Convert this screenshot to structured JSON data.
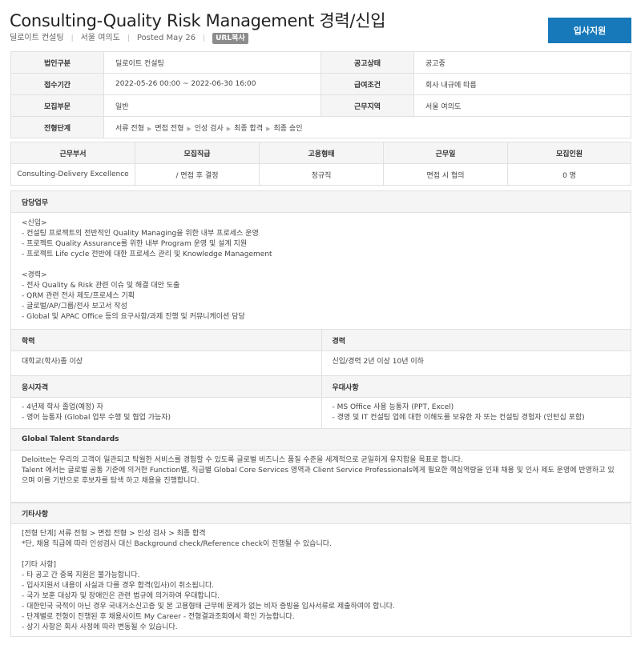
{
  "header": {
    "title": "Consulting-Quality Risk Management 경력/신입",
    "company": "딜로이트 컨설팅",
    "location": "서울 여의도",
    "posted": "Posted May 26",
    "url_copy": "URL복사",
    "apply_label": "입사지원"
  },
  "info": {
    "corp_label": "법인구분",
    "corp_value": "딜로이트 컨설팅",
    "status_label": "공고상태",
    "status_value": "공고중",
    "period_label": "접수기간",
    "period_value": "2022-05-26 00:00 ~ 2022-06-30 16:00",
    "salary_label": "급여조건",
    "salary_value": "회사 내규에 따름",
    "dept_label": "모집부문",
    "dept_value": "일반",
    "workplace_label": "근무지역",
    "workplace_value": "서울 여의도",
    "process_label": "전형단계",
    "process_steps": [
      "서류 전형",
      "면접 전형",
      "인성 검사",
      "최종 합격",
      "최종 승인"
    ]
  },
  "positions": {
    "headers": [
      "근무부서",
      "모집직급",
      "고용형태",
      "근무일",
      "모집인원"
    ],
    "row": [
      "Consulting-Delivery Excellence",
      "/ 면접 후 결정",
      "정규직",
      "면접 시 협의",
      "0 명"
    ]
  },
  "duties": {
    "title": "담당업무",
    "body": "<신입>\n- 컨설팅 프로젝트의 전반적인 Quality Managing을 위한 내부 프로세스 운영\n- 프로젝트 Quality Assurance를 위한 내부 Program 운영 및 설계 지원\n- 프로젝트 Life cycle 전반에 대한 프로세스 관리 및 Knowledge Management\n\n<경력>\n- 전사 Quality & Risk 관련 이슈 및 해결 대안 도출\n- QRM 관련 전사 제도/프로세스 기획\n- 글로벌/AP/그룹/전사 보고서 작성\n- Global 및 APAC Office 등의 요구사항/과제 진행 및 커뮤니케이션 담당"
  },
  "education": {
    "title": "학력",
    "value": "대학교(학사)졸 이상"
  },
  "career": {
    "title": "경력",
    "value": "신입/경력 2년 이상 10년 이하"
  },
  "qualification": {
    "title": "응시자격",
    "body": "- 4년제 학사 졸업(예정) 자\n- 영어 능통자 (Global 업무 수행 및 협업 가능자)"
  },
  "preference": {
    "title": "우대사항",
    "body": "- MS Office 사용 능통자 (PPT, Excel)\n- 경영 및 IT 컨설팅 업에 대한 이해도를 보유한 자 또는 컨설팅 경험자 (인턴십 포함)"
  },
  "talent": {
    "title": "Global Talent Standards",
    "body": "Deloitte는 우리의 고객이 일관되고 탁월한 서비스를 경험할 수 있도록 글로벌 비즈니스 품질 수준을 세계적으로 균일하게 유지함을 목표로 합니다.\nTalent 에서는 글로벌 공통 기준에 의거한 Function별, 직급별 Global Core Services 영역과 Client Service Professionals에게 필요한 핵심역량을 인재 채용 및 인사 제도 운영에 반영하고 있으며 이를 기반으로 후보자를 탐색 하고 채용을 진행합니다."
  },
  "etc": {
    "title": "기타사항",
    "body": "[전형 단계] 서류 전형 > 면접 전형 > 인성 검사 > 최종 합격\n*단, 채용 직급에 따라 인성검사 대신 Background check/Reference check이 진행될 수 있습니다.\n\n[기타 사항]\n- 타 공고 간 중복 지원은 불가능합니다.\n- 입사지원서 내용이 사실과 다를 경우 합격(입사)이 취소됩니다.\n- 국가 보훈 대상자 및 장애인은 관련 법규에 의거하여 우대합니다.\n- 대한민국 국적이 아닌 경우 국내거소신고증 및 본 고용형태 근무에 문제가 없는 비자 증빙을 입사서류로 제출하여야 합니다.\n- 단계별로 전형이 진행된 후 채용사이트 My Career - 전형결과조회에서 확인 가능합니다.\n- 상기 사항은 회사 사정에 따라 변동될 수 있습니다."
  }
}
